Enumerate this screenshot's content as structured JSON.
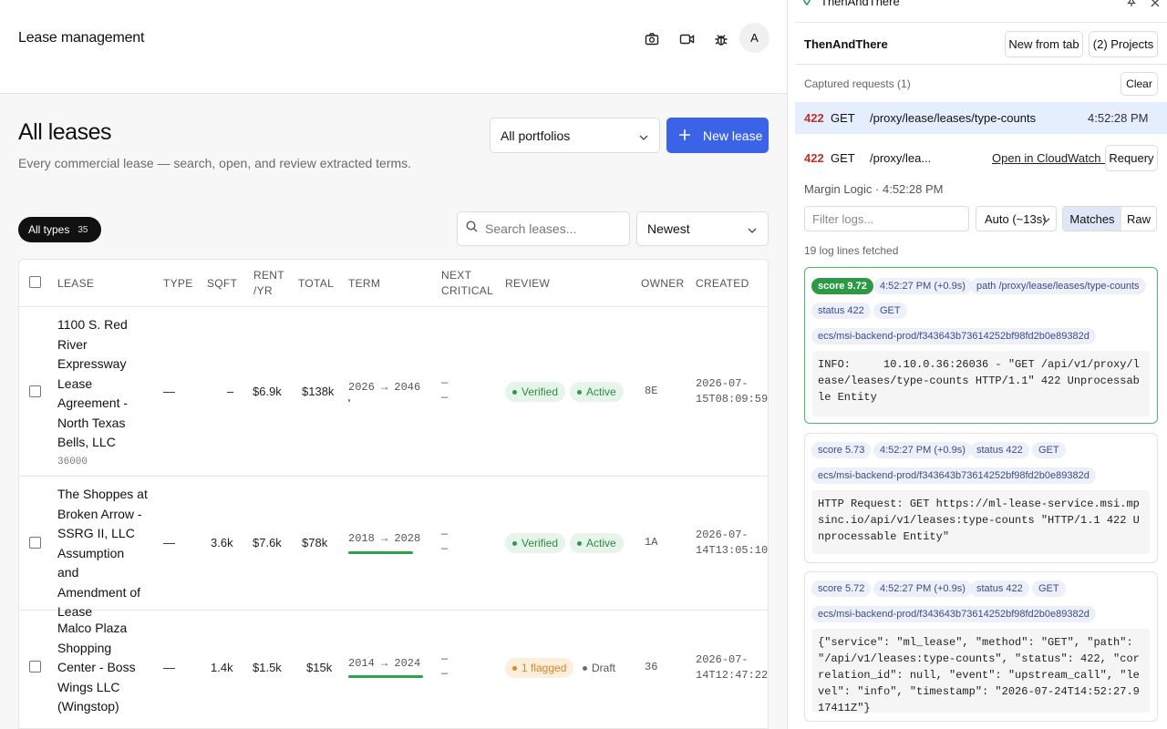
{
  "app": {
    "title": "Lease management",
    "avatar": "A",
    "page_title": "All leases",
    "page_subtitle": "Every commercial lease — search, open, and review extracted terms.",
    "portfolio_select": "All portfolios",
    "new_lease_label": "New lease",
    "type_filter": {
      "label": "All types",
      "count": "35"
    },
    "search_placeholder": "Search leases...",
    "sort_select": "Newest",
    "columns": [
      "Lease",
      "Type",
      "Sqft",
      "Rent /yr",
      "Total",
      "Term",
      "Next critical",
      "Review",
      "Owner",
      "Created"
    ],
    "rows": [
      {
        "name": "1100 S. Red River Expressway Lease Agreement - North Texas Bells, LLC",
        "id": "36000",
        "type": "—",
        "sqft": "–",
        "rent": "$6.9k",
        "total": "$138k",
        "term": "2026 → 2046",
        "term_progress": 0.01,
        "next1": "—",
        "next2": "—",
        "review1": "Verified",
        "review2": "Active",
        "owner": "8E",
        "created1": "2026-07-",
        "created2": "15T08:09:59"
      },
      {
        "name": "The Shoppes at Broken Arrow - SSRG II, LLC Assumption and Amendment of Lease",
        "id": "",
        "type": "—",
        "sqft": "3.6k",
        "rent": "$7.6k",
        "total": "$78k",
        "term": "2018 → 2028",
        "term_progress": 0.86,
        "next1": "—",
        "next2": "—",
        "review1": "Verified",
        "review2": "Active",
        "owner": "1A",
        "created1": "2026-07-",
        "created2": "14T13:05:10"
      },
      {
        "name": "Malco Plaza Shopping Center - Boss Wings LLC (Wingstop)",
        "id": "",
        "type": "—",
        "sqft": "1.4k",
        "rent": "$1.5k",
        "total": "$15k",
        "term": "2014 → 2024",
        "term_progress": 1.0,
        "next1": "—",
        "next2": "—",
        "review1": "1 flagged",
        "review2": "Draft",
        "owner": "36",
        "created1": "2026-07-",
        "created2": "14T12:47:22"
      }
    ]
  },
  "panel": {
    "extension_name": "ThenAndThere",
    "title": "ThenAndThere",
    "new_from_tab": "New from tab",
    "projects": "(2) Projects",
    "captured_label": "Captured requests (1)",
    "clear": "Clear",
    "request": {
      "status": "422",
      "method": "GET",
      "path": "/proxy/lease/leases/type-counts",
      "time": "4:52:28 PM"
    },
    "detail": {
      "status": "422",
      "method": "GET",
      "path": "/proxy/lea...",
      "open_link": "Open in CloudWatch ↗",
      "requery": "Requery"
    },
    "meta": "Margin Logic · 4:52:28 PM",
    "filter_placeholder": "Filter logs...",
    "auto_select": "Auto (~13s)",
    "seg_matches": "Matches",
    "seg_raw": "Raw",
    "fetched": "19 log lines fetched",
    "cards": [
      {
        "score": "score 9.72",
        "time": "4:52:27 PM (+0.9s)",
        "path": "path /proxy/lease/leases/type-counts",
        "status": "status 422",
        "method": "GET",
        "stream": "ecs/msi-backend-prod/f343643b73614252bf98fd2b0e89382d",
        "text": "INFO:     10.10.0.36:26036 - \"GET /api/v1/proxy/lease/leases/type-counts HTTP/1.1\" 422 Unprocessable Entity"
      },
      {
        "score": "score 5.73",
        "time": "4:52:27 PM (+0.9s)",
        "status": "status 422",
        "method": "GET",
        "stream": "ecs/msi-backend-prod/f343643b73614252bf98fd2b0e89382d",
        "text": "HTTP Request: GET https://ml-lease-service.msi.mpsinc.io/api/v1/leases:type-counts \"HTTP/1.1 422 Unprocessable Entity\""
      },
      {
        "score": "score 5.72",
        "time": "4:52:27 PM (+0.9s)",
        "status": "status 422",
        "method": "GET",
        "stream": "ecs/msi-backend-prod/f343643b73614252bf98fd2b0e89382d",
        "text": "{\"service\": \"ml_lease\", \"method\": \"GET\", \"path\": \"/api/v1/leases:type-counts\", \"status\": 422, \"correlation_id\": null, \"event\": \"upstream_call\", \"level\": \"info\", \"timestamp\": \"2026-07-24T14:52:27.917411Z\"}"
      }
    ]
  },
  "colors": {
    "primary": "#3b63e8",
    "verified": "#2f8a45",
    "flagged": "#d8861e",
    "error": "#c0302b",
    "selected_row": "#e5eefc"
  }
}
